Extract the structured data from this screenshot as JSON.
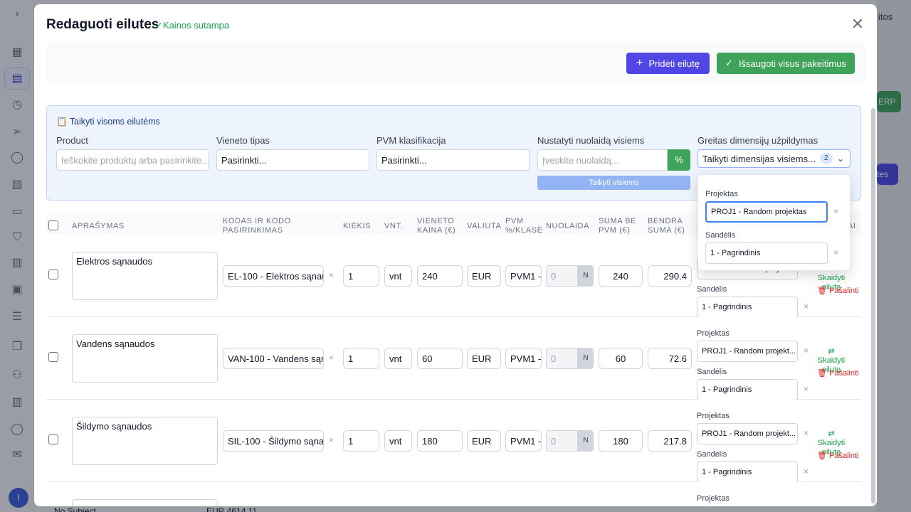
{
  "background": {
    "right_text": "itos",
    "right_btn": "ERP",
    "right_btn2": "tes",
    "bottom_row": "No Subject",
    "bottom_amount": "EUR 4614.11",
    "avatar": "I"
  },
  "modal": {
    "title": "Redaguoti eilutes",
    "match_text": "✓Kainos sutampa",
    "add_button": "Pridėti eilutę",
    "save_button": "Išsaugoti visus pakeitimus"
  },
  "apply_all": {
    "title": "📋 Taikyti visoms eilutėms",
    "product_label": "Product",
    "product_placeholder": "Ieškokite produktų arba pasirinkite...",
    "unit_label": "Vieneto tipas",
    "unit_value": "Pasirinkti...",
    "vat_label": "PVM klasifikacija",
    "vat_value": "Pasirinkti...",
    "discount_label": "Nustatyti nuolaidą visiems",
    "discount_placeholder": "Įveskite nuolaidą...",
    "percent": "%",
    "apply_button": "Taikyti visiems",
    "dim_label": "Greitas dimensijų užpildymas",
    "dim_select": "Taikyti dimensijas visiems...",
    "dim_count": "2"
  },
  "popup": {
    "project_label": "Projektas",
    "project_value": "PROJ1 - Random projektas",
    "warehouse_label": "Sandėlis",
    "warehouse_value": "1 - Pagrindinis"
  },
  "columns": {
    "desc": "APRAŠYMAS",
    "code": "KODAS IR KODO PASIRINKIMAS",
    "qty": "KIEKIS",
    "unit": "VNT.",
    "price": "VIENETO KAINA (€)",
    "currency": "VALIUTA",
    "vat": "PVM %/KLASĖ",
    "discount": "NUOLAIDA",
    "net": "SUMA BE PVM (€)",
    "total": "BENDRA SUMA (€)",
    "dims": "D",
    "actions": "AI"
  },
  "row_labels": {
    "project": "Projektas",
    "warehouse": "Sandėlis",
    "split": "Skaidyti eilutę",
    "delete": "Pašalinti",
    "n": "N",
    "x": "×",
    "discount_ph": "0"
  },
  "rows": [
    {
      "desc": "Elektros sąnaudos",
      "code": "EL-100 - Elektros sąnaudos",
      "qty": "1",
      "unit": "vnt",
      "price": "240",
      "currency": "EUR",
      "vat": "PVM1 -",
      "net": "240",
      "total": "290.4",
      "project": "PROJ1 - Random projekt...",
      "warehouse": "1 - Pagrindinis"
    },
    {
      "desc": "Vandens sąnaudos",
      "code": "VAN-100 - Vandens sąnaudos",
      "qty": "1",
      "unit": "vnt",
      "price": "60",
      "currency": "EUR",
      "vat": "PVM1 -",
      "net": "60",
      "total": "72.6",
      "project": "PROJ1 - Random projekt...",
      "warehouse": "1 - Pagrindinis"
    },
    {
      "desc": "Šildymo sąnaudos",
      "code": "SIL-100 - Šildymo sąnaudos",
      "qty": "1",
      "unit": "vnt",
      "price": "180",
      "currency": "EUR",
      "vat": "PVM1 -",
      "net": "180",
      "total": "217.8",
      "project": "PROJ1 - Random projekt...",
      "warehouse": "1 - Pagrindinis"
    }
  ]
}
